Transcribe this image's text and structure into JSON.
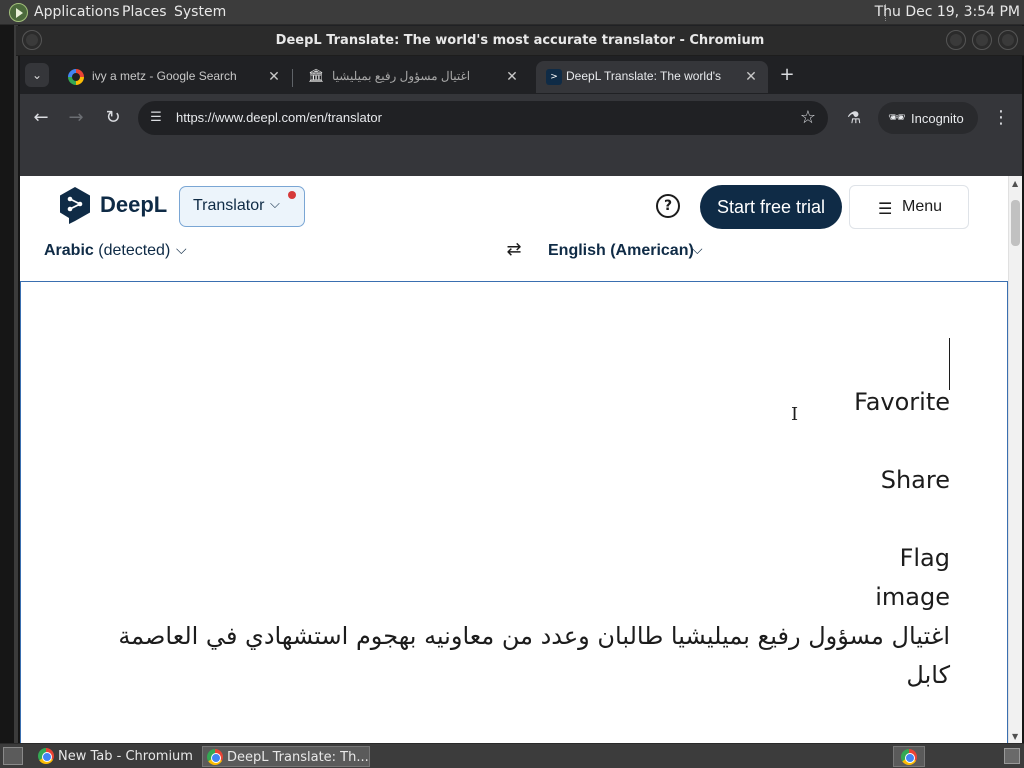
{
  "top_panel": {
    "menus": [
      "Applications",
      "Places",
      "System"
    ],
    "clock": "Thu Dec 19,  3:54 PM"
  },
  "window": {
    "title": "DeepL Translate: The world's most accurate translator - Chromium"
  },
  "tabs": [
    {
      "title": "ivy a metz - Google Search",
      "favicon": "google-icon"
    },
    {
      "title": "اغتيال مسؤول رفيع بميليشيا",
      "favicon": "bank-icon"
    },
    {
      "title": "DeepL Translate: The world's",
      "favicon": "deepl-icon",
      "active": true
    }
  ],
  "toolbar": {
    "url": "https://www.deepl.com/en/translator",
    "incognito_label": "Incognito"
  },
  "deepl": {
    "logo_text": "DeepL",
    "translator_label": "Translator",
    "trial_label": "Start free trial",
    "menu_label": "Menu",
    "help_glyph": "?",
    "source_lang_bold": "Arabic",
    "source_lang_suffix": " (detected)",
    "target_lang": "English (American)",
    "source_lines": [
      "Favorite",
      "Share",
      "Flag",
      "image",
      "اغتيال مسؤول رفيع بميليشيا طالبان وعدد من معاونيه بهجوم استشهادي في العاصمة",
      "كابل"
    ]
  },
  "taskbar": {
    "items": [
      "New Tab - Chromium",
      "DeepL Translate: Th..."
    ]
  },
  "colors": {
    "deepl_navy": "#0f2b46",
    "focus_border": "#3a6fb0",
    "chrome_dark": "#202124",
    "chrome_toolbar": "#35363a"
  }
}
